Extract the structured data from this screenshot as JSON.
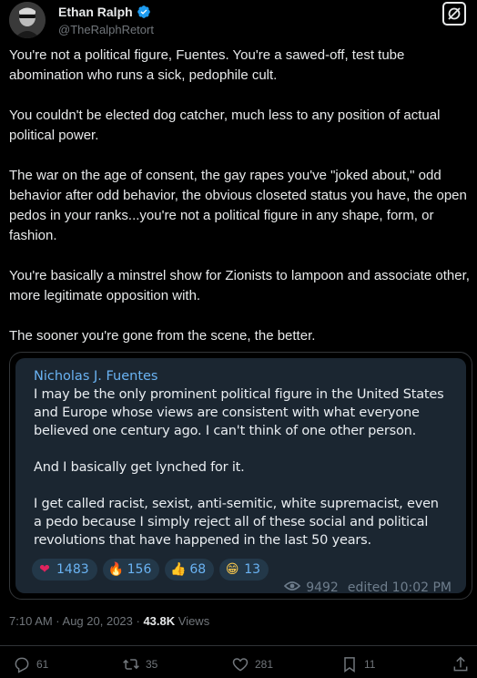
{
  "author": {
    "name": "Ethan Ralph",
    "handle": "@TheRalphRetort"
  },
  "tweet": {
    "paragraphs": [
      "You're not a political figure, Fuentes. You're a sawed-off, test tube abomination who runs a sick, pedophile cult.",
      "You couldn't be elected dog catcher, much less to any position of actual political power.",
      "The war on the age of consent, the gay rapes you've \"joked about,\" odd behavior after odd behavior, the obvious closeted status you have, the open pedos in your ranks...you're not a political figure in any shape, form, or fashion.",
      "You're basically a minstrel show for Zionists to lampoon and associate other, more legitimate opposition with.",
      "The sooner you're gone from the scene, the better."
    ]
  },
  "quote": {
    "author": "Nicholas J. Fuentes",
    "paragraphs": [
      "I may be the only prominent political figure in the United States and Europe whose views are consistent with what everyone believed one century ago. I can't think of one other person.",
      "And I basically get lynched for it.",
      "I get called racist, sexist, anti-semitic, white supremacist, even a pedo because I simply reject all of these social and political revolutions that have happened in the last 50 years."
    ],
    "reactions": [
      {
        "emoji": "❤",
        "count": "1483",
        "color": "#e0245e"
      },
      {
        "emoji": "🔥",
        "count": "156",
        "color": "#f4900c"
      },
      {
        "emoji": "👍",
        "count": "68",
        "color": "#ffcc4d"
      },
      {
        "emoji": "😁",
        "count": "13",
        "color": "#ffcc4d"
      }
    ],
    "views": "9492",
    "edited": "edited 10:02 PM"
  },
  "meta": {
    "time": "7:10 AM · Aug 20, 2023 · ",
    "views_count": "43.8K",
    "views_label": " Views"
  },
  "actions": {
    "replies": "61",
    "reposts": "35",
    "likes": "281",
    "bookmarks": "11"
  },
  "colors": {
    "accent": "#1d9bf0",
    "quote_bg": "#1b2631",
    "quote_link": "#6ab3f3"
  }
}
